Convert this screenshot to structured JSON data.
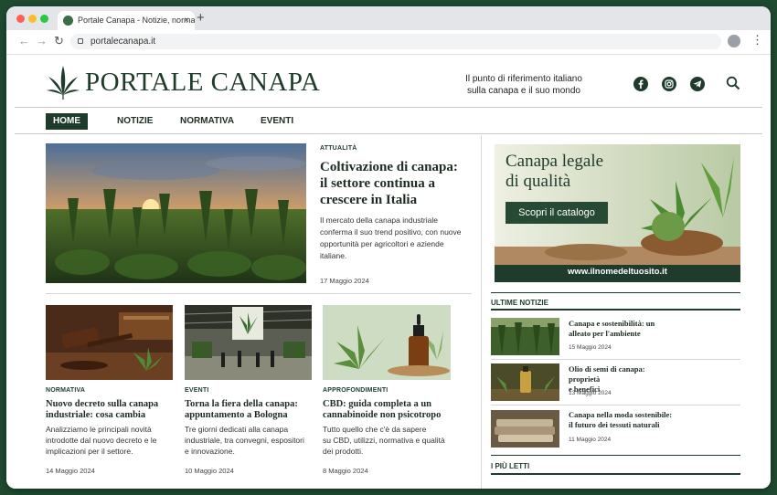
{
  "browser": {
    "tab_title": "Portale Canapa - Notizie, normati",
    "tab_close": "×",
    "new_tab": "+",
    "url": "portalecanapa.it"
  },
  "header": {
    "brand": "PORTALE CANAPA",
    "tagline_line1": "Il punto di riferimento italiano",
    "tagline_line2": "sulla canapa e il suo mondo"
  },
  "menu": [
    "HOME",
    "NOTIZIE",
    "NORMATIVA",
    "EVENTI"
  ],
  "featured": {
    "category": "ATTUALITÀ",
    "title_lines": [
      "Coltivazione di canapa:",
      "il settore continua a",
      "crescere in Italia"
    ],
    "excerpt_lines": [
      "Il mercato della canapa industriale",
      "conferma il suo trend positivo, con nuove",
      "opportunità per agricoltori e aziende",
      "italiane."
    ],
    "date": "17 Maggio 2024"
  },
  "articles": [
    {
      "category": "NORMATIVA",
      "title_lines": [
        "Nuovo decreto sulla canapa",
        "industriale: cosa cambia"
      ],
      "excerpt_lines": [
        "Analizziamo le principali novità",
        "introdotte dal nuovo decreto e le",
        "implicazioni per il settore."
      ],
      "date": "14 Maggio 2024"
    },
    {
      "category": "EVENTI",
      "title_lines": [
        "Torna la fiera della canapa:",
        "appuntamento a Bologna"
      ],
      "excerpt_lines": [
        "Tre giorni dedicati alla canapa",
        "industriale, tra convegni, espositori",
        "e innovazione."
      ],
      "date": "10 Maggio 2024"
    },
    {
      "category": "APPROFONDIMENTI",
      "title_lines": [
        "CBD: guida completa a un",
        "cannabinoide non psicotropo"
      ],
      "excerpt_lines": [
        "Tutto quello che c'è da sapere",
        "su CBD, utilizzi, normativa e qualità",
        "dei prodotti."
      ],
      "date": "8 Maggio 2024"
    }
  ],
  "banner": {
    "headline_line1": "Canapa legale",
    "headline_line2": "di qualità",
    "button": "Scopri il catalogo",
    "site": "www.ilnomedeltuosito.it"
  },
  "sidebar": {
    "latest_title": "ULTIME NOTIZIE",
    "latest": [
      {
        "title_lines": [
          "Canapa e sostenibilità: un",
          "alleato per l'ambiente"
        ],
        "date": "15 Maggio 2024"
      },
      {
        "title_lines": [
          "Olio di semi di canapa: proprietà",
          "e benefici"
        ],
        "date": "13 Maggio 2024"
      },
      {
        "title_lines": [
          "Canapa nella moda sostenibile:",
          "il futuro dei tessuti naturali"
        ],
        "date": "11 Maggio 2024"
      }
    ],
    "popular_title": "I PIÙ LETTI"
  },
  "colors": {
    "brand_green": "#1e3b2b",
    "frame_green": "#1f4a30"
  }
}
